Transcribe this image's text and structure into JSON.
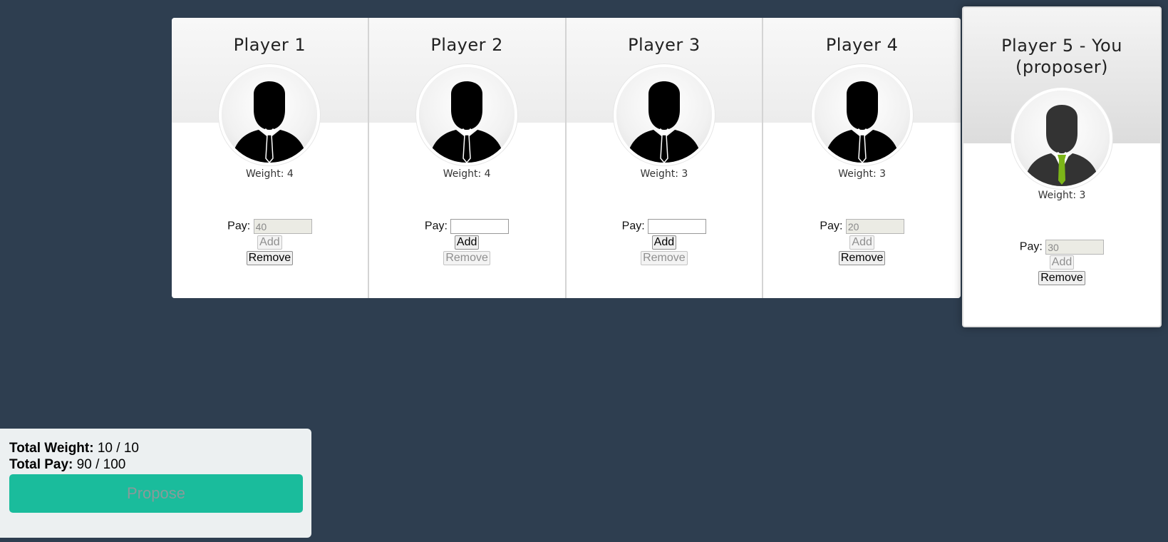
{
  "players": [
    {
      "title": "Player 1",
      "weight_label": "Weight: 4",
      "pay_label": "Pay:",
      "pay_value": "40",
      "pay_disabled": true,
      "add_label": "Add",
      "add_disabled": true,
      "remove_label": "Remove",
      "remove_disabled": false
    },
    {
      "title": "Player 2",
      "weight_label": "Weight: 4",
      "pay_label": "Pay:",
      "pay_value": "",
      "pay_disabled": false,
      "add_label": "Add",
      "add_disabled": false,
      "remove_label": "Remove",
      "remove_disabled": true
    },
    {
      "title": "Player 3",
      "weight_label": "Weight: 3",
      "pay_label": "Pay:",
      "pay_value": "",
      "pay_disabled": false,
      "add_label": "Add",
      "add_disabled": false,
      "remove_label": "Remove",
      "remove_disabled": true
    },
    {
      "title": "Player 4",
      "weight_label": "Weight: 3",
      "pay_label": "Pay:",
      "pay_value": "20",
      "pay_disabled": true,
      "add_label": "Add",
      "add_disabled": true,
      "remove_label": "Remove",
      "remove_disabled": false
    }
  ],
  "you": {
    "title_line1": "Player 5 - You",
    "title_line2": "(proposer)",
    "weight_label": "Weight: 3",
    "pay_label": "Pay:",
    "pay_value": "30",
    "add_label": "Add",
    "remove_label": "Remove",
    "tie_color": "#7cb518"
  },
  "summary": {
    "weight_label": "Total Weight:",
    "weight_value": "10 / 10",
    "pay_label": "Total Pay:",
    "pay_value": "90 / 100",
    "propose_label": "Propose"
  },
  "colors": {
    "background": "#2e3e50",
    "propose": "#1abc9c",
    "panel": "#ecf0f1"
  },
  "icons": {
    "player_avatar": "businessman-avatar-icon",
    "you_avatar": "businessman-green-tie-avatar-icon"
  }
}
